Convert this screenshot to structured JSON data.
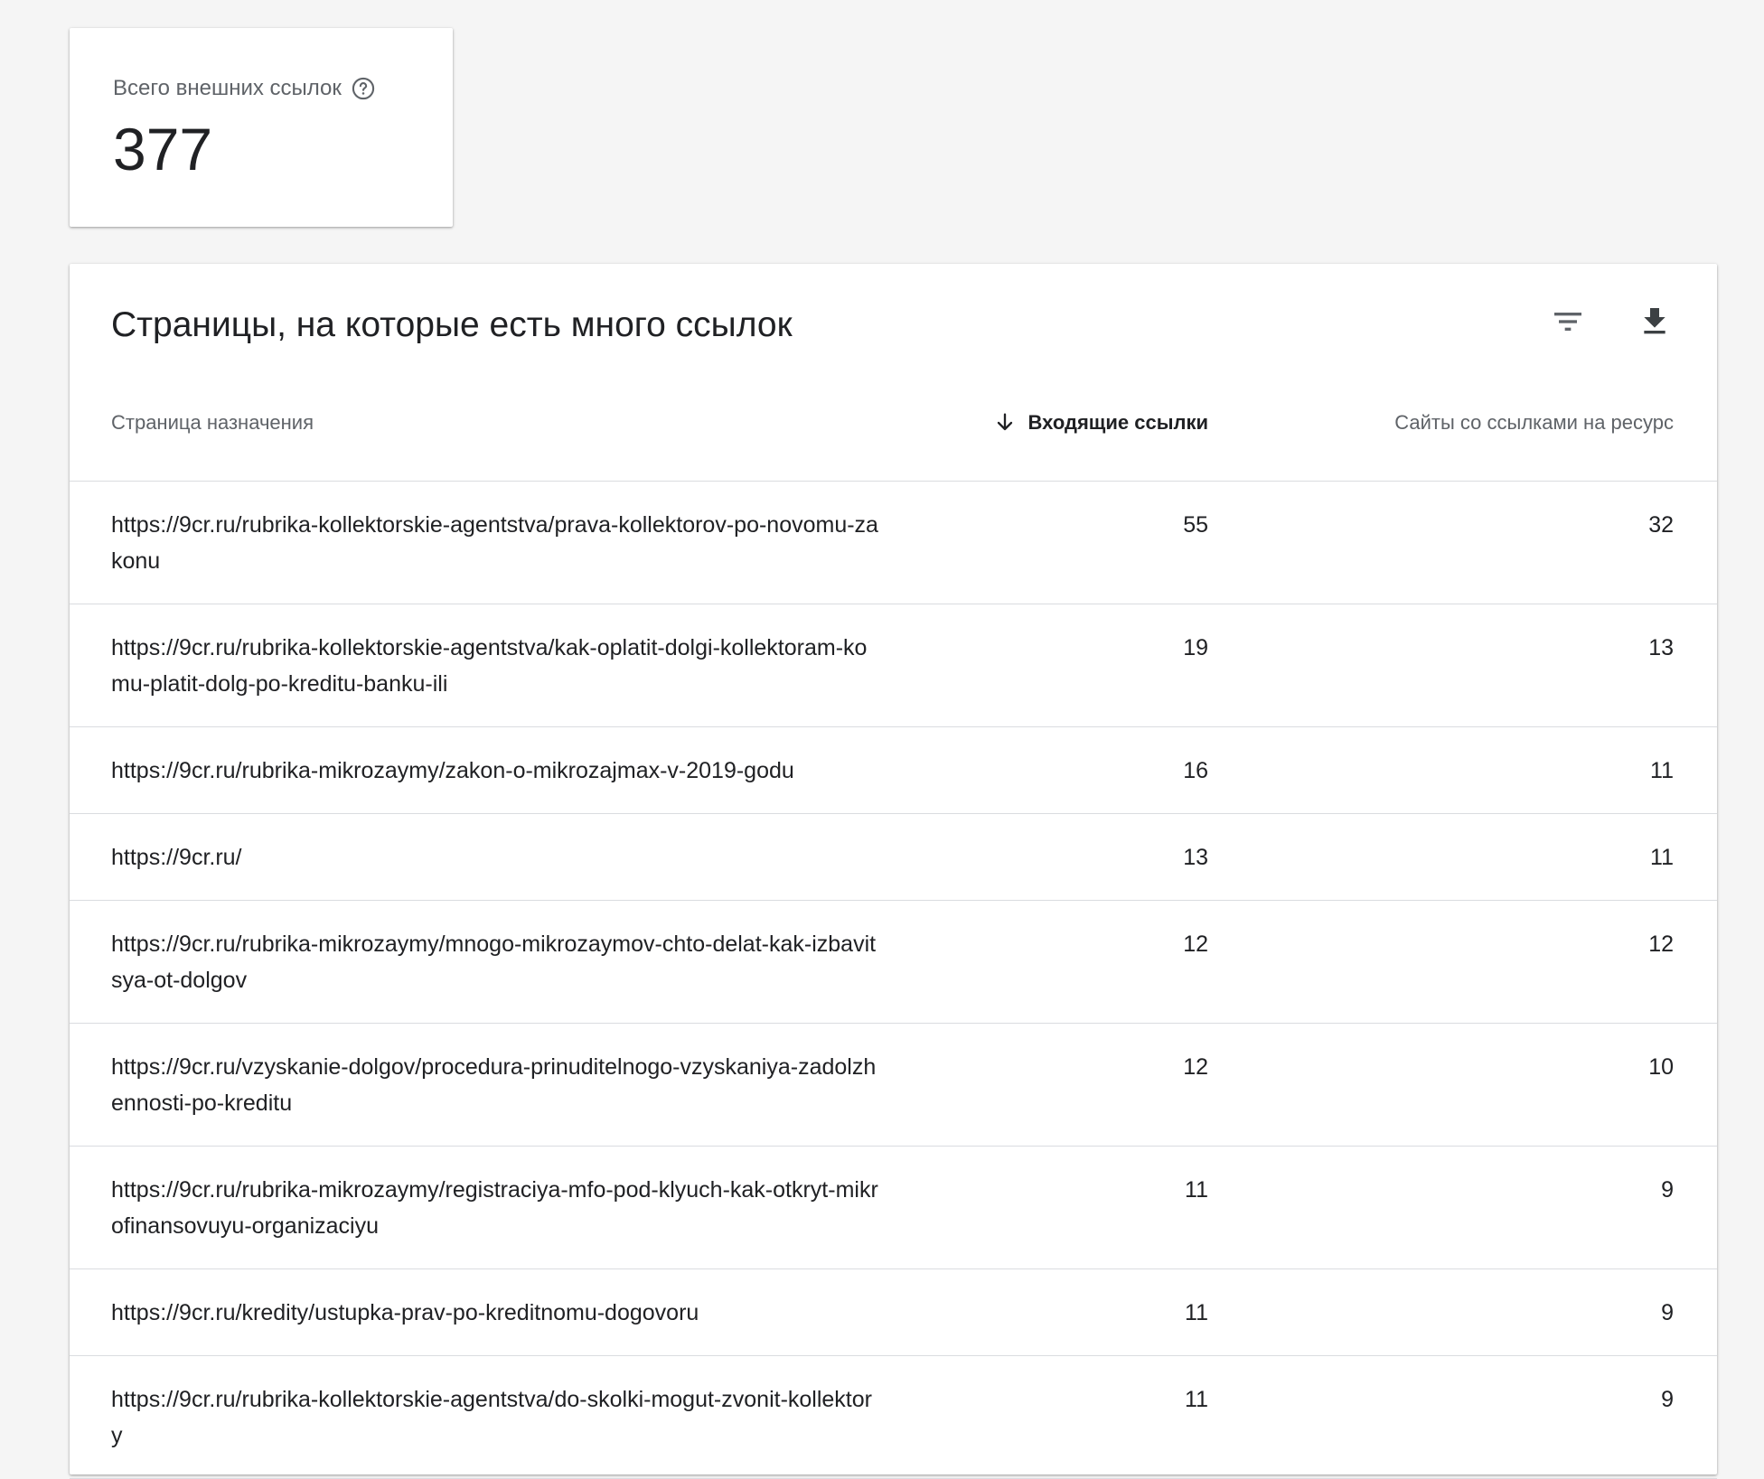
{
  "summary": {
    "label": "Всего внешних ссылок",
    "value": "377"
  },
  "table_card": {
    "title": "Страницы, на которые есть много ссылок",
    "columns": {
      "page": "Страница назначения",
      "inbound": "Входящие ссылки",
      "sites": "Сайты со ссылками на ресурс"
    },
    "rows": [
      {
        "url": "https://9cr.ru/rubrika-kollektorskie-agentstva/prava-kollektorov-po-novomu-zakonu",
        "inbound": "55",
        "sites": "32"
      },
      {
        "url": "https://9cr.ru/rubrika-kollektorskie-agentstva/kak-oplatit-dolgi-kollektoram-komu-platit-dolg-po-kreditu-banku-ili",
        "inbound": "19",
        "sites": "13"
      },
      {
        "url": "https://9cr.ru/rubrika-mikrozaymy/zakon-o-mikrozajmax-v-2019-godu",
        "inbound": "16",
        "sites": "11"
      },
      {
        "url": "https://9cr.ru/",
        "inbound": "13",
        "sites": "11"
      },
      {
        "url": "https://9cr.ru/rubrika-mikrozaymy/mnogo-mikrozaymov-chto-delat-kak-izbavitsya-ot-dolgov",
        "inbound": "12",
        "sites": "12"
      },
      {
        "url": "https://9cr.ru/vzyskanie-dolgov/procedura-prinuditelnogo-vzyskaniya-zadolzhennosti-po-kreditu",
        "inbound": "12",
        "sites": "10"
      },
      {
        "url": "https://9cr.ru/rubrika-mikrozaymy/registraciya-mfo-pod-klyuch-kak-otkryt-mikrofinansovuyu-organizaciyu",
        "inbound": "11",
        "sites": "9"
      },
      {
        "url": "https://9cr.ru/kredity/ustupka-prav-po-kreditnomu-dogovoru",
        "inbound": "11",
        "sites": "9"
      },
      {
        "url": "https://9cr.ru/rubrika-kollektorskie-agentstva/do-skolki-mogut-zvonit-kollektory",
        "inbound": "11",
        "sites": "9"
      }
    ]
  },
  "icons": {
    "help": "help-circle-icon",
    "filter": "filter-icon",
    "download": "download-icon",
    "sort": "arrow-down-icon"
  },
  "colors": {
    "background": "#f5f5f5",
    "card": "#ffffff",
    "text_primary": "#202124",
    "text_secondary": "#5f6368",
    "divider": "#dadce0"
  }
}
